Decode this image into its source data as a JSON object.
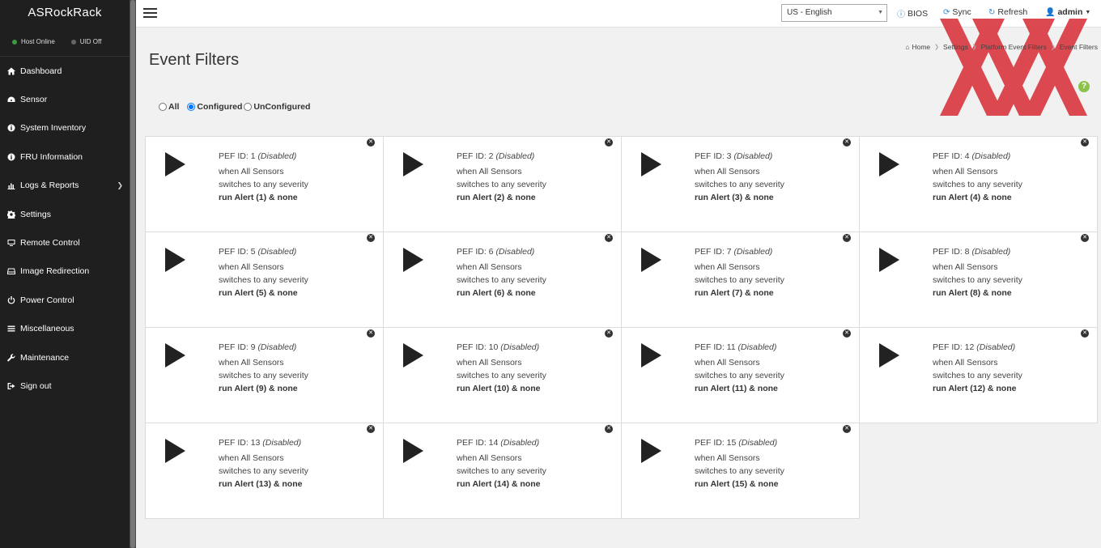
{
  "sidebar": {
    "brand": "ASRockRack",
    "status": [
      {
        "label": "Host Online",
        "color": "#3c9b3c"
      },
      {
        "label": "UID Off",
        "color": "#666666"
      }
    ],
    "nav": [
      {
        "label": "Dashboard",
        "icon": "home-icon"
      },
      {
        "label": "Sensor",
        "icon": "gauge-icon"
      },
      {
        "label": "System Inventory",
        "icon": "info-icon"
      },
      {
        "label": "FRU Information",
        "icon": "info-icon"
      },
      {
        "label": "Logs & Reports",
        "icon": "chart-icon"
      },
      {
        "label": "Settings",
        "icon": "gear-icon"
      },
      {
        "label": "Remote Control",
        "icon": "monitor-icon"
      },
      {
        "label": "Image Redirection",
        "icon": "disk-icon"
      },
      {
        "label": "Power Control",
        "icon": "power-icon"
      },
      {
        "label": "Miscellaneous",
        "icon": "list-icon"
      },
      {
        "label": "Maintenance",
        "icon": "wrench-icon"
      },
      {
        "label": "Sign out",
        "icon": "signout-icon"
      }
    ]
  },
  "topbar": {
    "language": "US - English",
    "bios": "BIOS",
    "sync": "Sync",
    "refresh": "Refresh",
    "user": "admin"
  },
  "page": {
    "title": "Event Filters",
    "breadcrumb": [
      "Home",
      "Settings",
      "Platform Event Filters",
      "Event Filters"
    ],
    "filters": {
      "all": "All",
      "configured": "Configured",
      "unconfigured": "UnConfigured",
      "selected": "configured"
    }
  },
  "cards": [
    {
      "id": "PEF ID: 1",
      "state": "(Disabled)",
      "line2": "when All Sensors",
      "line3": "switches to any severity",
      "line4": "run Alert (1) & none"
    },
    {
      "id": "PEF ID: 2",
      "state": "(Disabled)",
      "line2": "when All Sensors",
      "line3": "switches to any severity",
      "line4": "run Alert (2) & none"
    },
    {
      "id": "PEF ID: 3",
      "state": "(Disabled)",
      "line2": "when All Sensors",
      "line3": "switches to any severity",
      "line4": "run Alert (3) & none"
    },
    {
      "id": "PEF ID: 4",
      "state": "(Disabled)",
      "line2": "when All Sensors",
      "line3": "switches to any severity",
      "line4": "run Alert (4) & none"
    },
    {
      "id": "PEF ID: 5",
      "state": "(Disabled)",
      "line2": "when All Sensors",
      "line3": "switches to any severity",
      "line4": "run Alert (5) & none"
    },
    {
      "id": "PEF ID: 6",
      "state": "(Disabled)",
      "line2": "when All Sensors",
      "line3": "switches to any severity",
      "line4": "run Alert (6) & none"
    },
    {
      "id": "PEF ID: 7",
      "state": "(Disabled)",
      "line2": "when All Sensors",
      "line3": "switches to any severity",
      "line4": "run Alert (7) & none"
    },
    {
      "id": "PEF ID: 8",
      "state": "(Disabled)",
      "line2": "when All Sensors",
      "line3": "switches to any severity",
      "line4": "run Alert (8) & none"
    },
    {
      "id": "PEF ID: 9",
      "state": "(Disabled)",
      "line2": "when All Sensors",
      "line3": "switches to any severity",
      "line4": "run Alert (9) & none"
    },
    {
      "id": "PEF ID: 10",
      "state": "(Disabled)",
      "line2": "when All Sensors",
      "line3": "switches to any severity",
      "line4": "run Alert (10) & none"
    },
    {
      "id": "PEF ID: 11",
      "state": "(Disabled)",
      "line2": "when All Sensors",
      "line3": "switches to any severity",
      "line4": "run Alert (11) & none"
    },
    {
      "id": "PEF ID: 12",
      "state": "(Disabled)",
      "line2": "when All Sensors",
      "line3": "switches to any severity",
      "line4": "run Alert (12) & none"
    },
    {
      "id": "PEF ID: 13",
      "state": "(Disabled)",
      "line2": "when All Sensors",
      "line3": "switches to any severity",
      "line4": "run Alert (13) & none"
    },
    {
      "id": "PEF ID: 14",
      "state": "(Disabled)",
      "line2": "when All Sensors",
      "line3": "switches to any severity",
      "line4": "run Alert (14) & none"
    },
    {
      "id": "PEF ID: 15",
      "state": "(Disabled)",
      "line2": "when All Sensors",
      "line3": "switches to any severity",
      "line4": "run Alert (15) & none"
    }
  ],
  "colors": {
    "sidebar": "#1f1f1f",
    "watermark": "#d9363e",
    "help": "#8bc34a",
    "info": "#3a87c8"
  }
}
